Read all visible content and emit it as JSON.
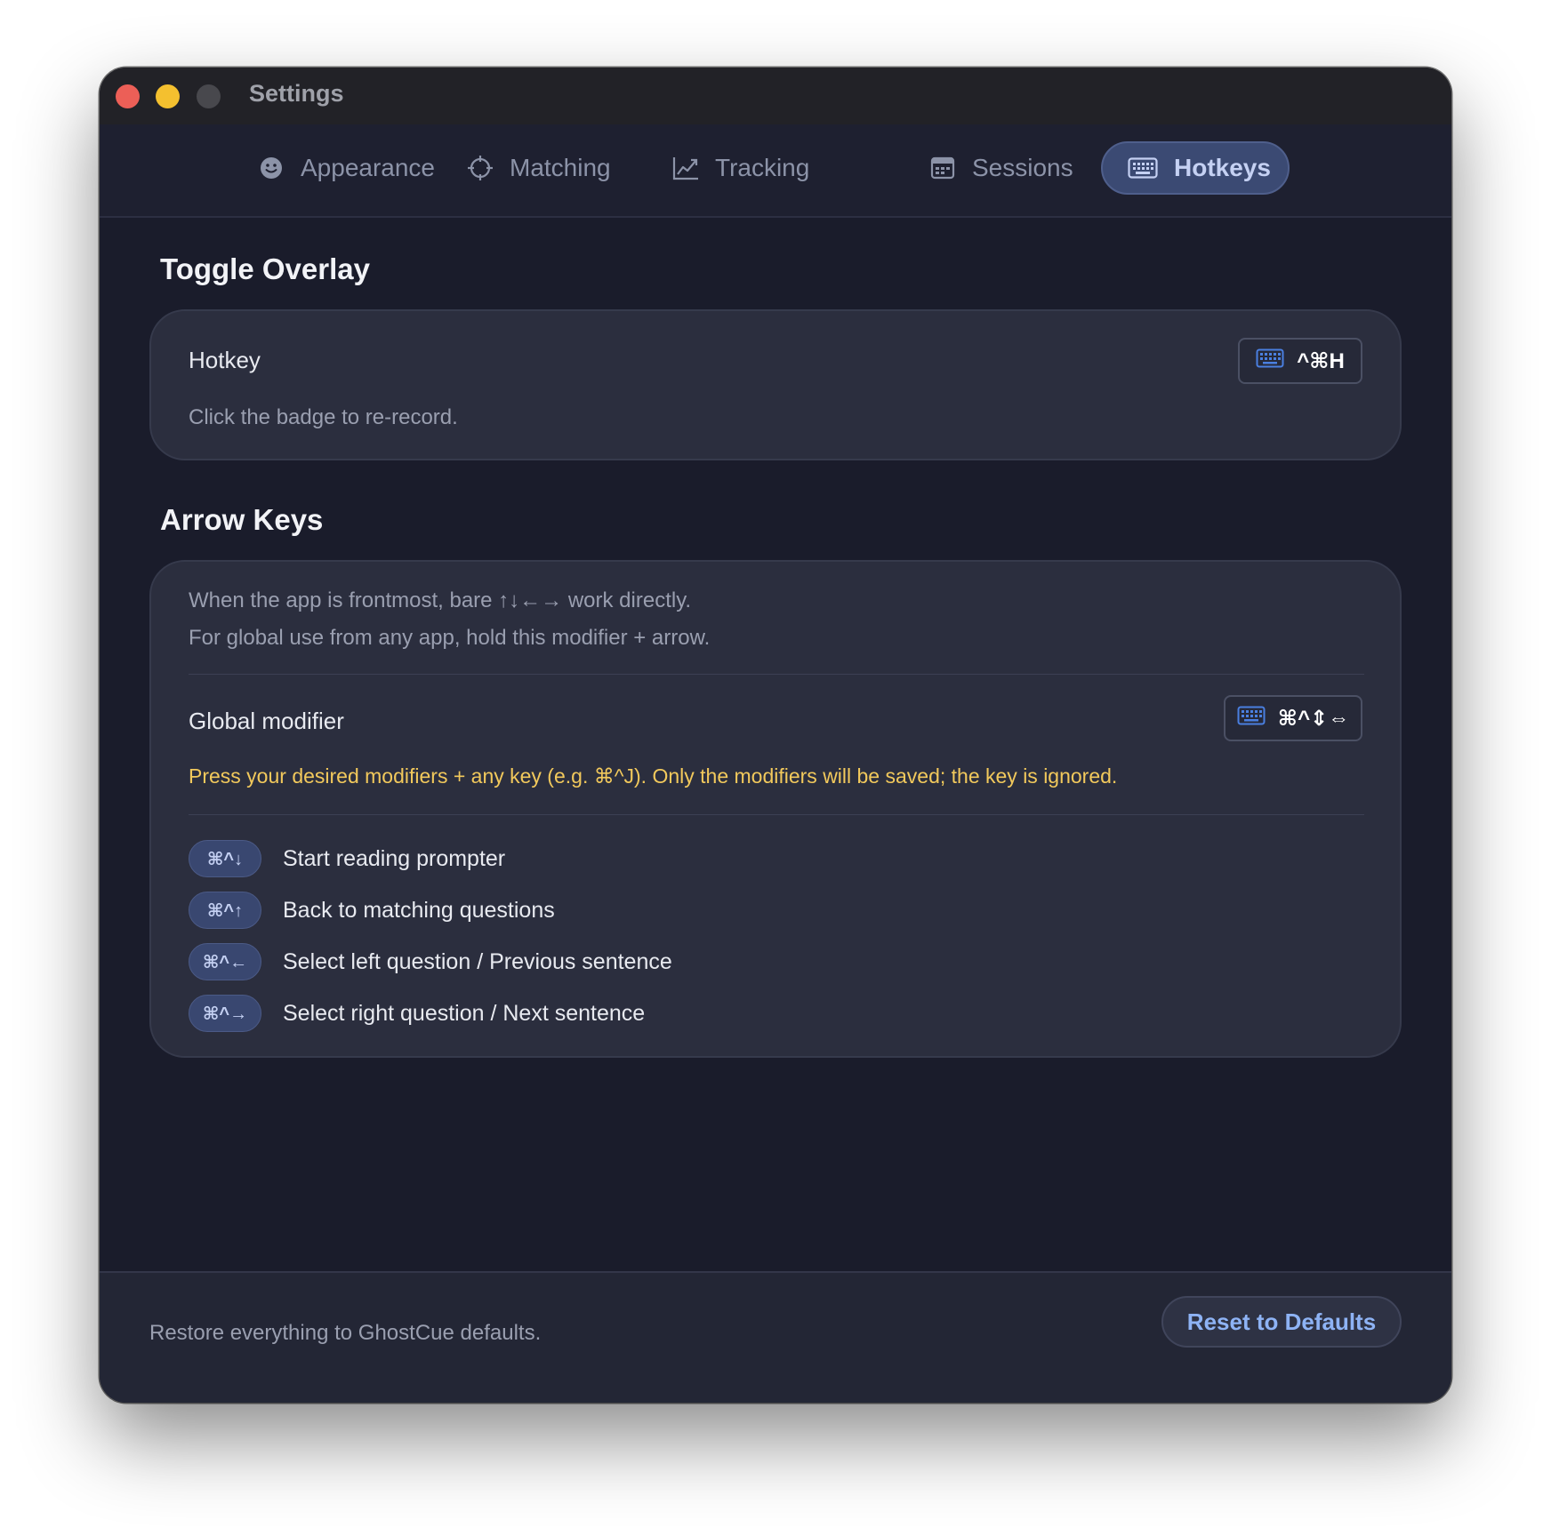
{
  "window": {
    "title": "Settings"
  },
  "tabs": [
    {
      "label": "Appearance",
      "icon": "smiley-icon",
      "active": false
    },
    {
      "label": "Matching",
      "icon": "crosshair-icon",
      "active": false
    },
    {
      "label": "Tracking",
      "icon": "line-chart-icon",
      "active": false
    },
    {
      "label": "Sessions",
      "icon": "calendar-icon",
      "active": false
    },
    {
      "label": "Hotkeys",
      "icon": "keyboard-icon",
      "active": true
    }
  ],
  "toggle_overlay": {
    "section_title": "Toggle Overlay",
    "hotkey_label": "Hotkey",
    "hotkey_value": "^⌘H",
    "help": "Click the badge to re-record."
  },
  "arrow_keys": {
    "section_title": "Arrow Keys",
    "description_line1": "When the app is frontmost, bare ↑↓←→ work directly.",
    "description_line2": "For global use from any app, hold this modifier + arrow.",
    "global_modifier_label": "Global modifier",
    "global_modifier_value": "⌘^⇕⇔",
    "hint": "Press your desired modifiers + any key (e.g. ⌘^J). Only the modifiers will be saved; the key is ignored.",
    "bindings": [
      {
        "keys": "⌘^↓",
        "action": "Start reading prompter"
      },
      {
        "keys": "⌘^↑",
        "action": "Back to matching questions"
      },
      {
        "keys": "⌘^←",
        "action": "Select left question / Previous sentence"
      },
      {
        "keys": "⌘^→",
        "action": "Select right question / Next sentence"
      }
    ]
  },
  "footer": {
    "text": "Restore everything to GhostCue defaults.",
    "reset_label": "Reset to Defaults"
  },
  "colors": {
    "accent": "#8eb3f5",
    "active_tab_bg": "#3b4a73",
    "hint": "#f2c95c",
    "window_bg": "#1a1c2b",
    "card_bg": "#2b2e3e"
  }
}
